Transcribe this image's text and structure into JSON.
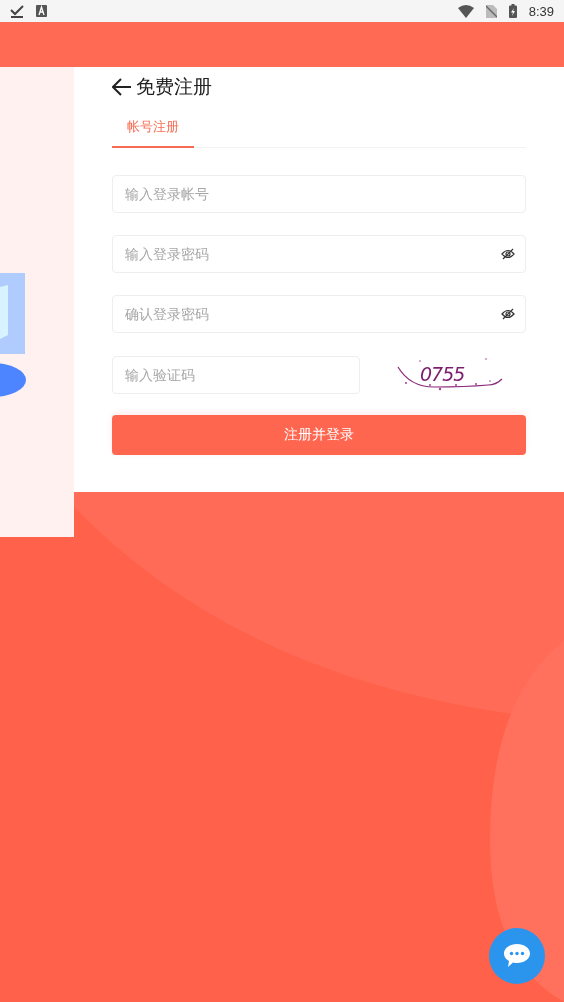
{
  "status_bar": {
    "time": "8:39"
  },
  "page": {
    "title": "免费注册"
  },
  "tabs": [
    {
      "label": "帐号注册",
      "selected": true
    }
  ],
  "fields": [
    {
      "placeholder": "输入登录帐号",
      "kind": "text"
    },
    {
      "placeholder": "输入登录密码",
      "kind": "password"
    },
    {
      "placeholder": "确认登录密码",
      "kind": "password"
    },
    {
      "placeholder": "输入验证码",
      "kind": "captcha",
      "captcha": "0755"
    }
  ],
  "submit": {
    "label": "注册并登录"
  }
}
